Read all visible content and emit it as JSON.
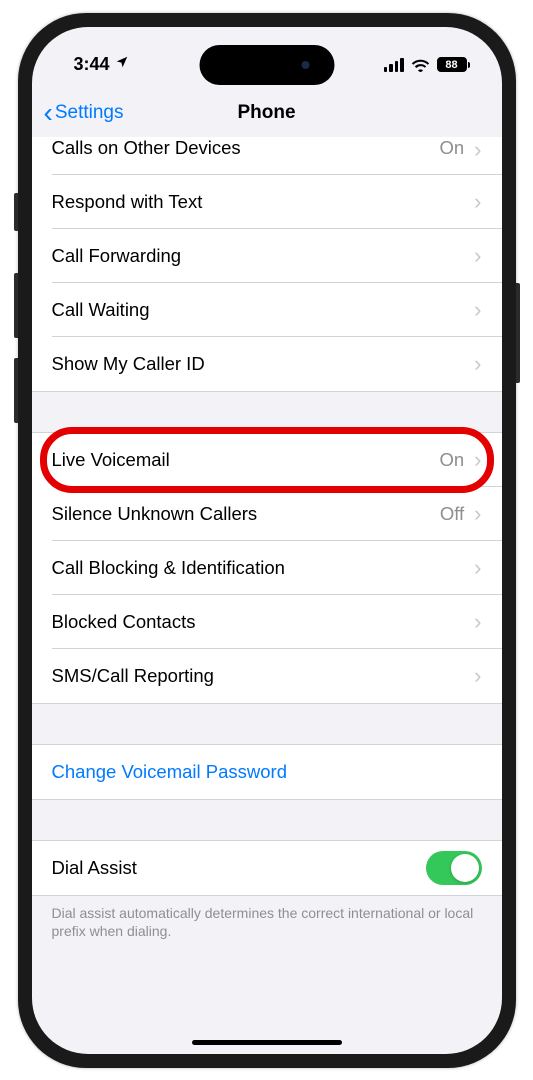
{
  "status": {
    "time": "3:44",
    "battery_pct": "88"
  },
  "nav": {
    "back": "Settings",
    "title": "Phone"
  },
  "group1": {
    "items": [
      {
        "label": "Calls on Other Devices",
        "value": "On"
      },
      {
        "label": "Respond with Text",
        "value": ""
      },
      {
        "label": "Call Forwarding",
        "value": ""
      },
      {
        "label": "Call Waiting",
        "value": ""
      },
      {
        "label": "Show My Caller ID",
        "value": ""
      }
    ]
  },
  "group2": {
    "items": [
      {
        "label": "Live Voicemail",
        "value": "On",
        "highlight": true
      },
      {
        "label": "Silence Unknown Callers",
        "value": "Off"
      },
      {
        "label": "Call Blocking & Identification",
        "value": ""
      },
      {
        "label": "Blocked Contacts",
        "value": ""
      },
      {
        "label": "SMS/Call Reporting",
        "value": ""
      }
    ]
  },
  "group3": {
    "link": "Change Voicemail Password"
  },
  "group4": {
    "label": "Dial Assist",
    "toggle": true,
    "footer": "Dial assist automatically determines the correct international or local prefix when dialing."
  }
}
